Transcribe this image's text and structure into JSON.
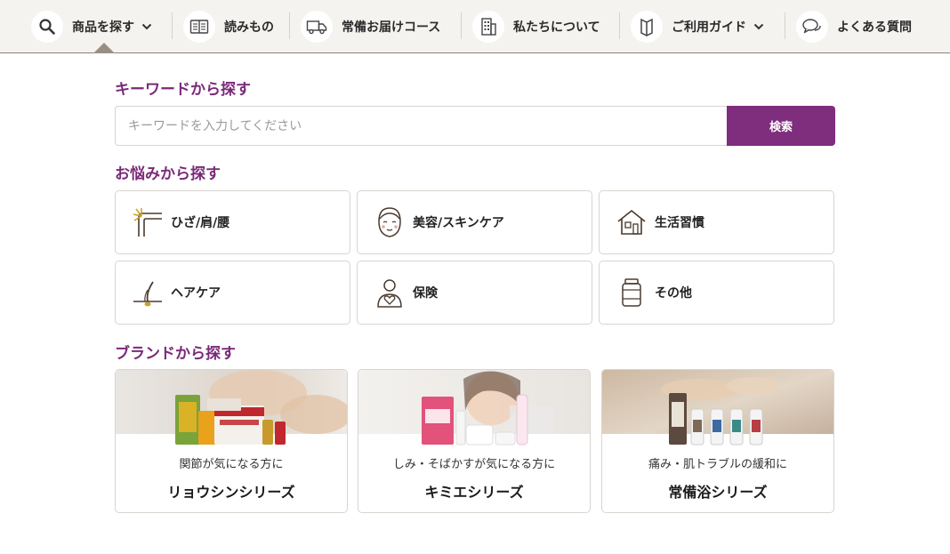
{
  "nav": {
    "items": [
      {
        "label": "商品を探す",
        "icon": "search-icon"
      },
      {
        "label": "読みもの",
        "icon": "book-icon"
      },
      {
        "label": "常備お届けコース",
        "icon": "delivery-truck-icon"
      },
      {
        "label": "私たちについて",
        "icon": "building-icon"
      },
      {
        "label": "ご利用ガイド",
        "icon": "guide-book-icon"
      },
      {
        "label": "よくある質問",
        "icon": "speech-bubbles-icon"
      }
    ]
  },
  "keyword_section": {
    "heading": "キーワードから探す",
    "search_placeholder": "キーワードを入力してください",
    "search_button": "検索"
  },
  "concern_section": {
    "heading": "お悩みから探す",
    "items": [
      {
        "label": "ひざ/肩/腰",
        "icon": "joint-icon"
      },
      {
        "label": "美容/スキンケア",
        "icon": "face-icon"
      },
      {
        "label": "生活習慣",
        "icon": "house-icon"
      },
      {
        "label": "ヘアケア",
        "icon": "hair-icon"
      },
      {
        "label": "保険",
        "icon": "person-heart-icon"
      },
      {
        "label": "その他",
        "icon": "bottle-icon"
      }
    ]
  },
  "brand_section": {
    "heading": "ブランドから探す",
    "items": [
      {
        "subtitle": "関節が気になる方に",
        "name": "リョウシンシリーズ"
      },
      {
        "subtitle": "しみ・そばかすが気になる方に",
        "name": "キミエシリーズ"
      },
      {
        "subtitle": "痛み・肌トラブルの緩和に",
        "name": "常備浴シリーズ"
      }
    ]
  },
  "colors": {
    "accent": "#7f2d7d",
    "heading": "#7a2a78",
    "nav_bg": "#f5f3f0",
    "border": "#d9d4cf"
  }
}
